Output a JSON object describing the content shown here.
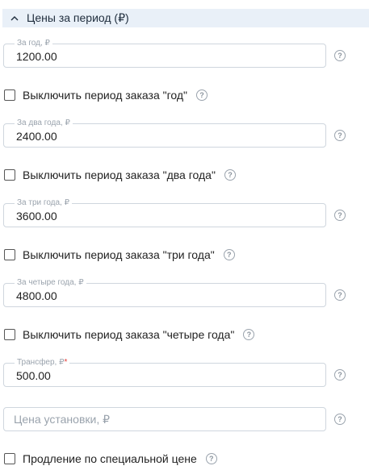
{
  "section": {
    "title": "Цены за период (₽)",
    "icon": "chevron-up-icon"
  },
  "fields": [
    {
      "label": "За год, ₽",
      "value": "1200.00"
    },
    {
      "label": "За два года, ₽",
      "value": "2400.00"
    },
    {
      "label": "За три года, ₽",
      "value": "3600.00"
    },
    {
      "label": "За четыре года, ₽",
      "value": "4800.00"
    },
    {
      "label": "Трансфер, ₽",
      "required_mark": "*",
      "value": "500.00"
    }
  ],
  "install_price": {
    "placeholder": "Цена установки, ₽",
    "value": ""
  },
  "checkboxes": [
    {
      "label": "Выключить период заказа \"год\"",
      "checked": false
    },
    {
      "label": "Выключить период заказа \"два года\"",
      "checked": false
    },
    {
      "label": "Выключить период заказа \"три года\"",
      "checked": false
    },
    {
      "label": "Выключить период заказа \"четыре года\"",
      "checked": false
    },
    {
      "label": "Продление по специальной цене",
      "checked": false
    }
  ],
  "help_icon": {
    "name": "help-icon",
    "glyph": "?"
  },
  "colors": {
    "header_bg": "#e9f0f8",
    "border": "#cfd6de",
    "muted_text": "#9aa3ad",
    "required": "#e53935"
  }
}
